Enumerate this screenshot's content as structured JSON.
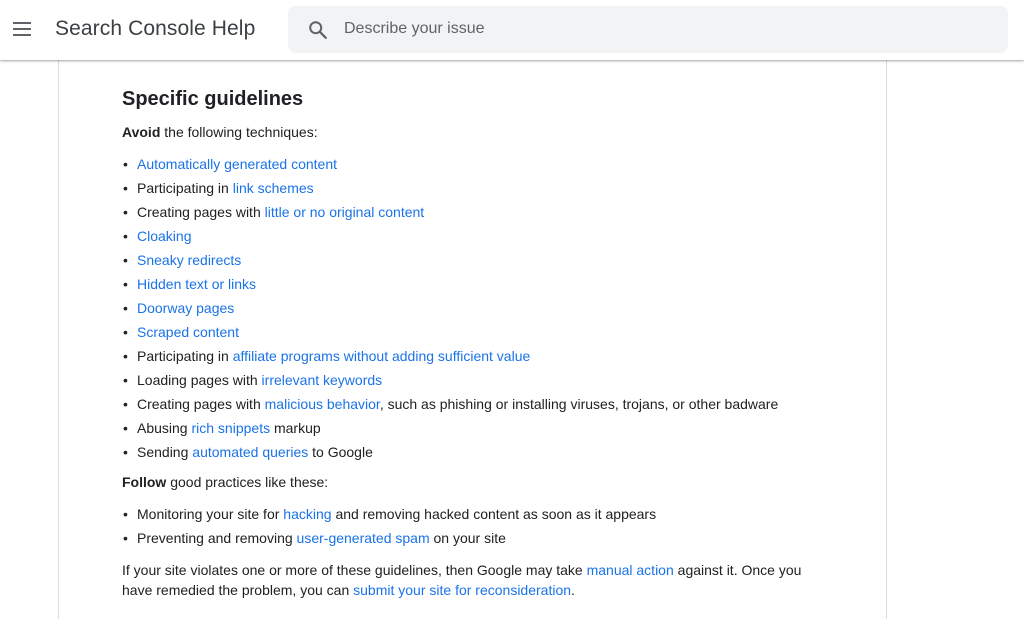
{
  "header": {
    "title": "Search Console Help",
    "search_placeholder": "Describe your issue"
  },
  "article": {
    "heading": "Specific guidelines",
    "avoid_intro": {
      "bold": "Avoid",
      "rest": " the following techniques:"
    },
    "avoid_items": [
      {
        "before": "",
        "link": "Automatically generated content",
        "after": ""
      },
      {
        "before": "Participating in ",
        "link": "link schemes",
        "after": ""
      },
      {
        "before": "Creating pages with ",
        "link": "little or no original content",
        "after": ""
      },
      {
        "before": "",
        "link": "Cloaking",
        "after": ""
      },
      {
        "before": "",
        "link": "Sneaky redirects",
        "after": ""
      },
      {
        "before": "",
        "link": "Hidden text or links",
        "after": ""
      },
      {
        "before": "",
        "link": "Doorway pages",
        "after": ""
      },
      {
        "before": "",
        "link": "Scraped content",
        "after": ""
      },
      {
        "before": "Participating in ",
        "link": "affiliate programs without adding sufficient value",
        "after": ""
      },
      {
        "before": "Loading pages with ",
        "link": "irrelevant keywords",
        "after": ""
      },
      {
        "before": "Creating pages with ",
        "link": "malicious behavior",
        "after": ", such as phishing or installing viruses, trojans, or other badware"
      },
      {
        "before": "Abusing ",
        "link": "rich snippets",
        "after": " markup"
      },
      {
        "before": "Sending ",
        "link": "automated queries",
        "after": " to Google"
      }
    ],
    "follow_intro": {
      "bold": "Follow",
      "rest": " good practices like these:"
    },
    "follow_items": [
      {
        "before": "Monitoring your site for ",
        "link": "hacking",
        "after": " and removing hacked content as soon as it appears"
      },
      {
        "before": "Preventing and removing ",
        "link": "user-generated spam",
        "after": " on your site"
      }
    ],
    "closing": {
      "part1": "If your site violates one or more of these guidelines, then Google may take ",
      "link1": "manual action",
      "part2": " against it. Once you have remedied the problem, you can ",
      "link2": "submit your site for reconsideration",
      "part3": "."
    }
  }
}
